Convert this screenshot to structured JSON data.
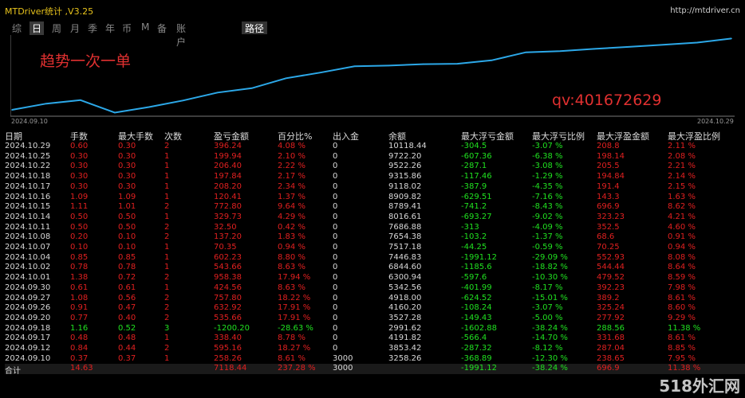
{
  "app": {
    "title": "MTDriver统计 ,V3.25",
    "url": "http://mtdriver.cn"
  },
  "tabs": [
    "综",
    "日",
    "周",
    "月",
    "季",
    "年",
    "币",
    "M",
    "备",
    "账户"
  ],
  "active_tab": "日",
  "route_label": "路径",
  "overlay_text1": "趋势一次一单",
  "overlay_text2": "qv:401672629",
  "date_start": "2024.09.10",
  "date_end": "2024.10.29",
  "chart_data": {
    "type": "line",
    "series": [
      {
        "values": [
          3258.26,
          3853.42,
          4191.82,
          2991.62,
          3527.28,
          4160.2,
          4918.0,
          5342.56,
          6300.94,
          6844.6,
          7446.83,
          7517.18,
          7654.38,
          7686.88,
          8016.61,
          8789.41,
          8909.82,
          9118.02,
          9315.86,
          9522.26,
          9722.2,
          10118.44
        ]
      }
    ],
    "color": "#2ca8e8",
    "ylim": [
      2800,
      10300
    ]
  },
  "table": {
    "headers": [
      "日期",
      "手数",
      "最大手数",
      "次数",
      "盈亏金额",
      "百分比%",
      "出入金",
      "余额",
      "最大浮亏金额",
      "最大浮亏比例",
      "最大浮盈金额",
      "最大浮盈比例"
    ],
    "rows": [
      [
        "2024.10.29",
        "0.60",
        "0.30",
        "2",
        "396.24",
        "4.08 %",
        "0",
        "10118.44",
        "-304.5",
        "-3.07 %",
        "208.8",
        "2.11 %"
      ],
      [
        "2024.10.25",
        "0.30",
        "0.30",
        "1",
        "199.94",
        "2.10 %",
        "0",
        "9722.20",
        "-607.36",
        "-6.38 %",
        "198.14",
        "2.08 %"
      ],
      [
        "2024.10.22",
        "0.30",
        "0.30",
        "1",
        "206.40",
        "2.22 %",
        "0",
        "9522.26",
        "-287.1",
        "-3.08 %",
        "205.5",
        "2.21 %"
      ],
      [
        "2024.10.18",
        "0.30",
        "0.30",
        "1",
        "197.84",
        "2.17 %",
        "0",
        "9315.86",
        "-117.46",
        "-1.29 %",
        "194.84",
        "2.14 %"
      ],
      [
        "2024.10.17",
        "0.30",
        "0.30",
        "1",
        "208.20",
        "2.34 %",
        "0",
        "9118.02",
        "-387.9",
        "-4.35 %",
        "191.4",
        "2.15 %"
      ],
      [
        "2024.10.16",
        "1.09",
        "1.09",
        "1",
        "120.41",
        "1.37 %",
        "0",
        "8909.82",
        "-629.51",
        "-7.16 %",
        "143.3",
        "1.63 %"
      ],
      [
        "2024.10.15",
        "1.11",
        "1.01",
        "2",
        "772.80",
        "9.64 %",
        "0",
        "8789.41",
        "-741.2",
        "-8.43 %",
        "696.9",
        "8.62 %"
      ],
      [
        "2024.10.14",
        "0.50",
        "0.50",
        "1",
        "329.73",
        "4.29 %",
        "0",
        "8016.61",
        "-693.27",
        "-9.02 %",
        "323.23",
        "4.21 %"
      ],
      [
        "2024.10.11",
        "0.50",
        "0.50",
        "2",
        "32.50",
        "0.42 %",
        "0",
        "7686.88",
        "-313",
        "-4.09 %",
        "352.5",
        "4.60 %"
      ],
      [
        "2024.10.08",
        "0.20",
        "0.10",
        "2",
        "137.20",
        "1.83 %",
        "0",
        "7654.38",
        "-103.2",
        "-1.37 %",
        "68.6",
        "0.91 %"
      ],
      [
        "2024.10.07",
        "0.10",
        "0.10",
        "1",
        "70.35",
        "0.94 %",
        "0",
        "7517.18",
        "-44.25",
        "-0.59 %",
        "70.25",
        "0.94 %"
      ],
      [
        "2024.10.04",
        "0.85",
        "0.85",
        "1",
        "602.23",
        "8.80 %",
        "0",
        "7446.83",
        "-1991.12",
        "-29.09 %",
        "552.93",
        "8.08 %"
      ],
      [
        "2024.10.02",
        "0.78",
        "0.78",
        "1",
        "543.66",
        "8.63 %",
        "0",
        "6844.60",
        "-1185.6",
        "-18.82 %",
        "544.44",
        "8.64 %"
      ],
      [
        "2024.10.01",
        "1.38",
        "0.72",
        "2",
        "958.38",
        "17.94 %",
        "0",
        "6300.94",
        "-597.6",
        "-10.30 %",
        "479.52",
        "8.59 %"
      ],
      [
        "2024.09.30",
        "0.61",
        "0.61",
        "1",
        "424.56",
        "8.63 %",
        "0",
        "5342.56",
        "-401.99",
        "-8.17 %",
        "392.23",
        "7.98 %"
      ],
      [
        "2024.09.27",
        "1.08",
        "0.56",
        "2",
        "757.80",
        "18.22 %",
        "0",
        "4918.00",
        "-624.52",
        "-15.01 %",
        "389.2",
        "8.61 %"
      ],
      [
        "2024.09.26",
        "0.91",
        "0.47",
        "2",
        "632.92",
        "17.91 %",
        "0",
        "4160.20",
        "-108.24",
        "-3.07 %",
        "325.24",
        "8.60 %"
      ],
      [
        "2024.09.20",
        "0.77",
        "0.40",
        "2",
        "535.66",
        "17.91 %",
        "0",
        "3527.28",
        "-149.43",
        "-5.00 %",
        "277.92",
        "9.29 %"
      ],
      [
        "2024.09.18",
        "1.16",
        "0.52",
        "3",
        "-1200.20",
        "-28.63 %",
        "0",
        "2991.62",
        "-1602.88",
        "-38.24 %",
        "288.56",
        "11.38 %"
      ],
      [
        "2024.09.17",
        "0.48",
        "0.48",
        "1",
        "338.40",
        "8.78 %",
        "0",
        "4191.82",
        "-566.4",
        "-14.70 %",
        "331.68",
        "8.61 %"
      ],
      [
        "2024.09.12",
        "0.84",
        "0.44",
        "2",
        "595.16",
        "18.27 %",
        "0",
        "3853.42",
        "-287.32",
        "-8.12 %",
        "287.04",
        "8.85 %"
      ],
      [
        "2024.09.10",
        "0.37",
        "0.37",
        "1",
        "258.26",
        "8.61 %",
        "3000",
        "3258.26",
        "-368.89",
        "-12.30 %",
        "238.65",
        "7.95 %"
      ]
    ],
    "summary": [
      "合计",
      "14.63",
      "",
      "",
      "7118.44",
      "237.28 %",
      "3000",
      "",
      "-1991.12",
      "-38.24 %",
      "696.9",
      "11.38 %"
    ]
  },
  "watermark": "518外汇网"
}
